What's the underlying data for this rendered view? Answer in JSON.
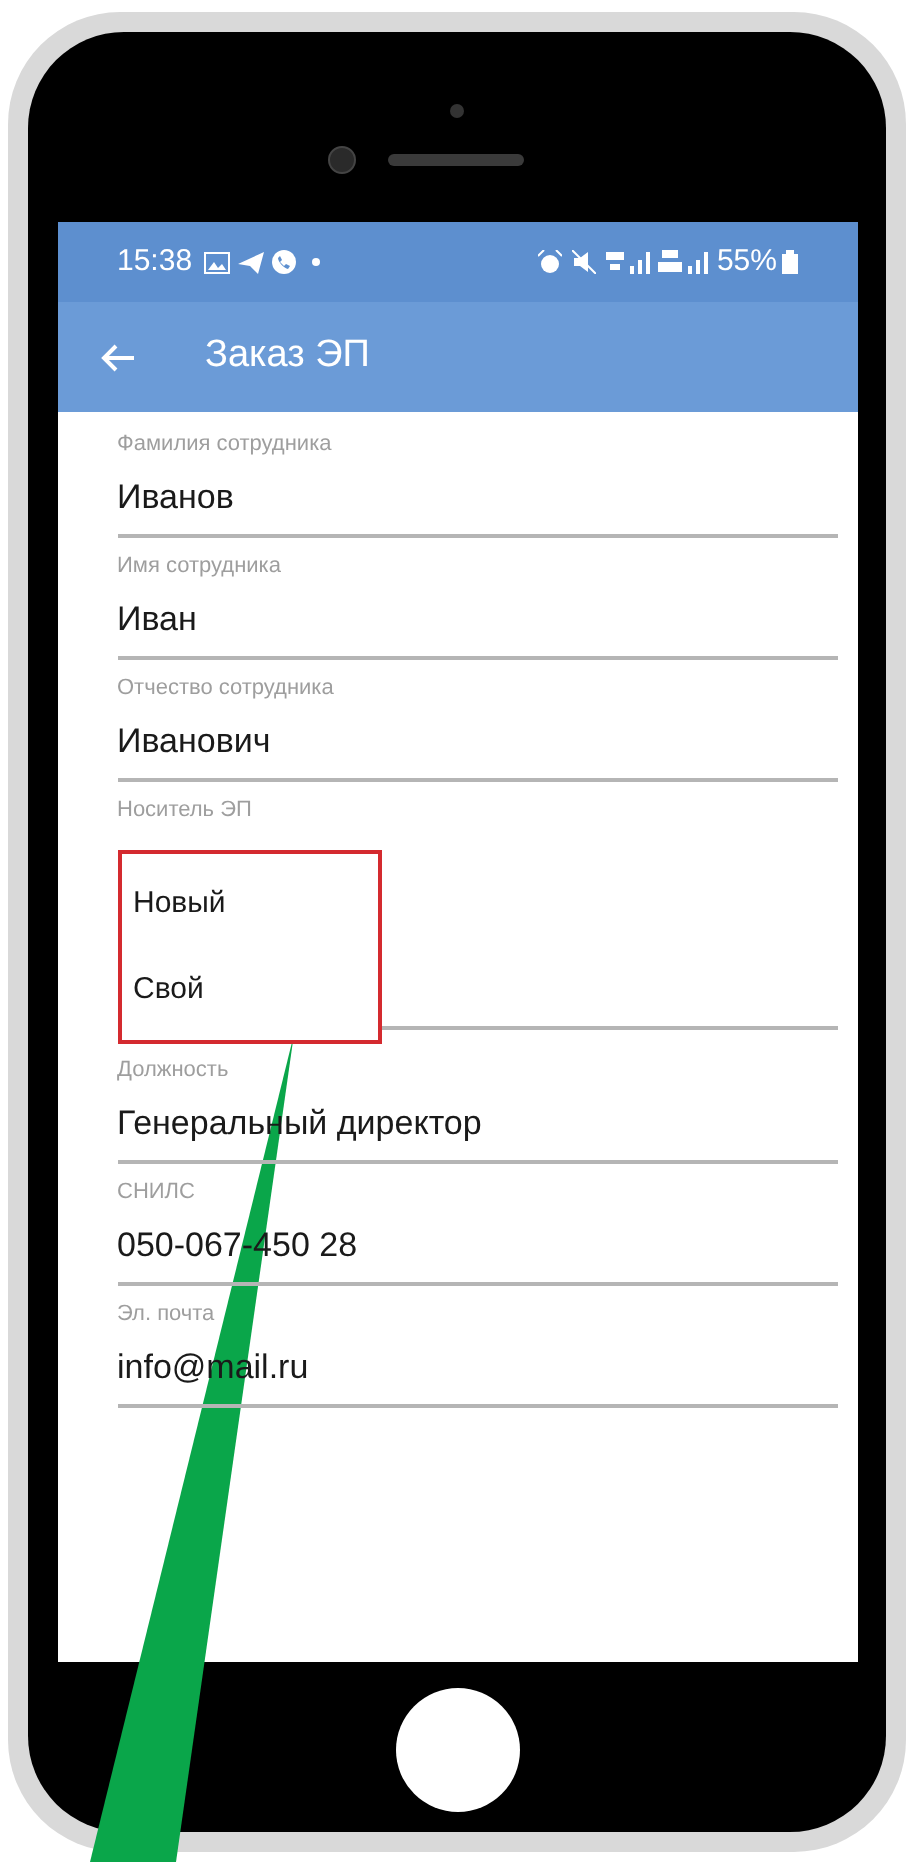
{
  "status_bar": {
    "time": "15:38",
    "battery": "55%"
  },
  "app_bar": {
    "title": "Заказ ЭП"
  },
  "fields": [
    {
      "kind": "text",
      "label": "Фамилия сотрудника",
      "value": "Иванов"
    },
    {
      "kind": "text",
      "label": "Имя сотрудника",
      "value": "Иван"
    },
    {
      "kind": "text",
      "label": "Отчество сотрудника",
      "value": "Иванович"
    },
    {
      "kind": "select",
      "label": "Носитель ЭП",
      "options": [
        "Новый",
        "Свой"
      ]
    },
    {
      "kind": "text",
      "label": "Должность",
      "value": "Генеральный директор"
    },
    {
      "kind": "text",
      "label": "СНИЛС",
      "value": "050-067-450 28"
    },
    {
      "kind": "text",
      "label": "Эл. почта",
      "value": "info@mail.ru"
    }
  ]
}
